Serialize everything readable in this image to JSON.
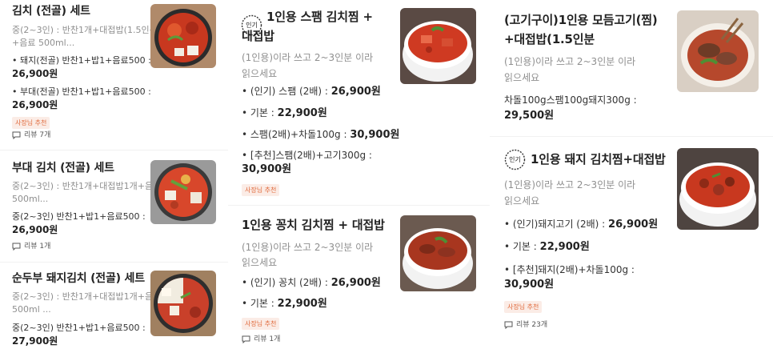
{
  "colors": {
    "badge_text": "#e06a3c",
    "badge_bg": "#fbece6",
    "desc": "#8f8f8f"
  },
  "col1": {
    "items": [
      {
        "title": "김치 (전골) 세트",
        "desc": [
          "중(2~3인) : 반찬1개+대접밥(1.5인분)",
          "+음료 500ml..."
        ],
        "options": [
          {
            "label": "• 돼지(전골) 반찬1+밥1+음료500 :",
            "price": "26,900원"
          },
          {
            "label": "• 부대(전골) 반찬1+밥1+음료500 :",
            "price": "26,900원"
          }
        ],
        "badge": "사장님 추천",
        "review": "리뷰 7개"
      },
      {
        "title": "부대 김치 (전골) 세트",
        "desc": [
          "중(2~3인) : 반찬1개+대접밥1개+음료",
          "500ml..."
        ],
        "options": [
          {
            "label": "중(2~3인) 반찬1+밥1+음료500 :",
            "price": "26,900원"
          }
        ],
        "review": "리뷰 1개"
      },
      {
        "title": "순두부 돼지김치 (전골) 세트",
        "desc": [
          "중(2~3인) : 반찬1개+대접밥1개+음료",
          "500ml ..."
        ],
        "options": [
          {
            "label": "중(2~3인) 반찬1+밥1+음료500 :",
            "price": "27,900원"
          }
        ]
      }
    ]
  },
  "col2": {
    "items": [
      {
        "popular": "인기",
        "title": [
          "1인용 스팸 김치찜 +",
          "대접밥"
        ],
        "desc": [
          "(1인용)이라 쓰고 2~3인분 이라",
          "읽으세요"
        ],
        "options": [
          {
            "label": "• (인기) 스팸 (2배) : ",
            "price": "26,900원"
          },
          {
            "label": "• 기본 : ",
            "price": "22,900원"
          },
          {
            "label": "• 스팸(2배)+차돌100g : ",
            "price": "30,900원"
          },
          {
            "label": "• [추천]스팸(2배)+고기300g :",
            "price": "30,900원"
          }
        ],
        "badge": "사장님 추천"
      },
      {
        "title": [
          "1인용 꽁치 김치찜 + 대접밥"
        ],
        "desc": [
          "(1인용)이라 쓰고 2~3인분 이라",
          "읽으세요"
        ],
        "options": [
          {
            "label": "• (인기) 꽁치 (2배) : ",
            "price": "26,900원"
          },
          {
            "label": "• 기본 : ",
            "price": "22,900원"
          }
        ],
        "badge": "사장님 추천",
        "review": "리뷰 1개"
      }
    ]
  },
  "col3": {
    "items": [
      {
        "title": [
          "(고기구이)1인용 모듬고기(찜)",
          "+대접밥(1.5인분"
        ],
        "desc": [
          "(1인용)이라 쓰고 2~3인분 이라",
          "읽으세요"
        ],
        "options": [
          {
            "label": "차돌100g스팸100g돼지300g :",
            "price": "29,500원"
          }
        ]
      },
      {
        "popular": "인기",
        "title": [
          "1인용 돼지 김치찜+대접밥"
        ],
        "desc": [
          "(1인용)이라 쓰고 2~3인분 이라",
          "읽으세요"
        ],
        "options": [
          {
            "label": "• (인기)돼지고기 (2배) : ",
            "price": "26,900원"
          },
          {
            "label": "• 기본 : ",
            "price": "22,900원"
          },
          {
            "label": "• [추천]돼지(2배)+차돌100g :",
            "price": "30,900원"
          }
        ],
        "badge": "사장님 추천",
        "review": "리뷰 23개"
      }
    ]
  }
}
